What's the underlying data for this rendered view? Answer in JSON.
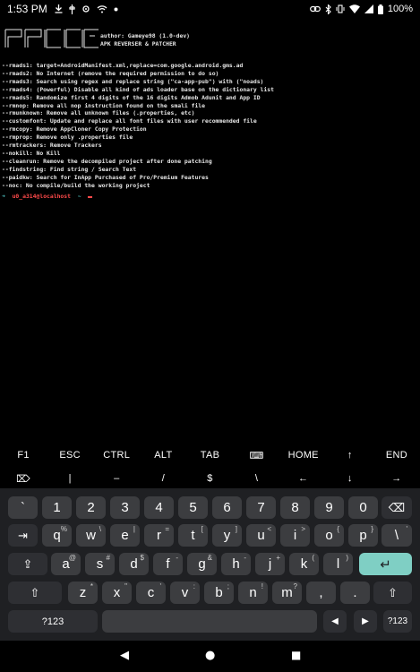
{
  "status_bar": {
    "time": "1:53 PM",
    "battery": "100%",
    "left_icons": [
      "download-icon",
      "usb-icon",
      "gear-icon",
      "wifi-icon",
      "dot-icon"
    ],
    "right_icons": [
      "link-icon",
      "bluetooth-icon",
      "vibrate-icon",
      "wifi-full-icon",
      "signal-icon",
      "battery-icon"
    ]
  },
  "terminal": {
    "banner_ascii": [
      "┌─┐┌─┐┌─┐┌─┐",
      "├─┘├─┘│  │  ",
      "┴  ┴  └─┘└─┘"
    ],
    "author_line": "author: Gameye98 (1.0-dev)",
    "subtitle_line": "APK REVERSER & PATCHER",
    "options": [
      "--rmads1: target=AndroidManifest.xml,replace=com.google.android.gms.ad",
      "--rmads2: No Internet (remove the required permission to do so)",
      "--rmads3: Search using regex and replace string (\"ca-app-pub\") with (\"noads)",
      "--rmads4: (Powerful) Disable all kind of ads loader base on the dictionary list",
      "--rmads5: Randomize first 4 digits of the 16 digits Admob Adunit and App ID",
      "--rmnop: Remove all nop instruction found on the smali file",
      "--rmunknown: Remove all unknown files (.properties, etc)",
      "--customfont: Update and replace all font files with user recommended file",
      "--rmcopy: Remove AppCloner Copy Protection",
      "--rmprop: Remove only .properties file",
      "--rmtrackers: Remove Trackers",
      "--nokill: No Kill",
      "--cleanrun: Remove the decompiled project after done patching",
      "--findstring: Find string / Search Text",
      "--paidkw: Search for InApp Purchased of Pro/Premium Features",
      "--noc: No compile/build the working project"
    ],
    "prompt_arrow": "➜",
    "prompt_user": "u0_a314@localhost",
    "prompt_tilde": "~"
  },
  "extra_keys": {
    "row1": [
      "F1",
      "ESC",
      "CTRL",
      "ALT",
      "TAB",
      "⌨",
      "HOME",
      "↑",
      "END"
    ],
    "row2": [
      "⌦",
      "|",
      "–",
      "/",
      "$",
      "\\",
      "←",
      "↓",
      "→"
    ]
  },
  "keyboard": {
    "row1": [
      {
        "label": "`",
        "sup": ""
      },
      {
        "label": "1",
        "sup": ""
      },
      {
        "label": "2",
        "sup": ""
      },
      {
        "label": "3",
        "sup": ""
      },
      {
        "label": "4",
        "sup": ""
      },
      {
        "label": "5",
        "sup": ""
      },
      {
        "label": "6",
        "sup": ""
      },
      {
        "label": "7",
        "sup": ""
      },
      {
        "label": "8",
        "sup": ""
      },
      {
        "label": "9",
        "sup": ""
      },
      {
        "label": "0",
        "sup": ""
      }
    ],
    "row2": [
      {
        "label": "q",
        "sup": "%"
      },
      {
        "label": "w",
        "sup": "\\"
      },
      {
        "label": "e",
        "sup": "|"
      },
      {
        "label": "r",
        "sup": "="
      },
      {
        "label": "t",
        "sup": "["
      },
      {
        "label": "y",
        "sup": "]"
      },
      {
        "label": "u",
        "sup": "<"
      },
      {
        "label": "i",
        "sup": ">"
      },
      {
        "label": "o",
        "sup": "{"
      },
      {
        "label": "p",
        "sup": "}"
      },
      {
        "label": "\\",
        "sup": "'"
      }
    ],
    "row3": [
      {
        "label": "a",
        "sup": "@"
      },
      {
        "label": "s",
        "sup": "#"
      },
      {
        "label": "d",
        "sup": "$"
      },
      {
        "label": "f",
        "sup": "-"
      },
      {
        "label": "g",
        "sup": "&"
      },
      {
        "label": "h",
        "sup": "-"
      },
      {
        "label": "j",
        "sup": "+"
      },
      {
        "label": "k",
        "sup": "("
      },
      {
        "label": "l",
        "sup": ")"
      }
    ],
    "row4": [
      {
        "label": "z",
        "sup": "*"
      },
      {
        "label": "x",
        "sup": "\""
      },
      {
        "label": "c",
        "sup": "'"
      },
      {
        "label": "v",
        "sup": ":"
      },
      {
        "label": "b",
        "sup": ";"
      },
      {
        "label": "n",
        "sup": "!"
      },
      {
        "label": "m",
        "sup": "?"
      },
      {
        "label": ",",
        "sup": ""
      },
      {
        "label": ".",
        "sup": ""
      }
    ],
    "symbols_label": "?123",
    "tab_glyph": "⇥",
    "backspace_glyph": "⌫",
    "enter_glyph": "↵",
    "shift_glyph": "⇧",
    "caps_glyph": "⇪",
    "left_glyph": "◀",
    "right_glyph": "▶",
    "colors": {
      "key": "#3c3d40",
      "fn_key": "#2e2f33",
      "enter": "#7fcfc4",
      "background": "#1f2023"
    }
  },
  "nav_bar": {
    "back": "◀",
    "home": "●",
    "recents": "■"
  },
  "terminal_colors": {
    "user": "#ff4a4a",
    "accent": "#4fc3c4",
    "text": "#e6e6e6"
  }
}
